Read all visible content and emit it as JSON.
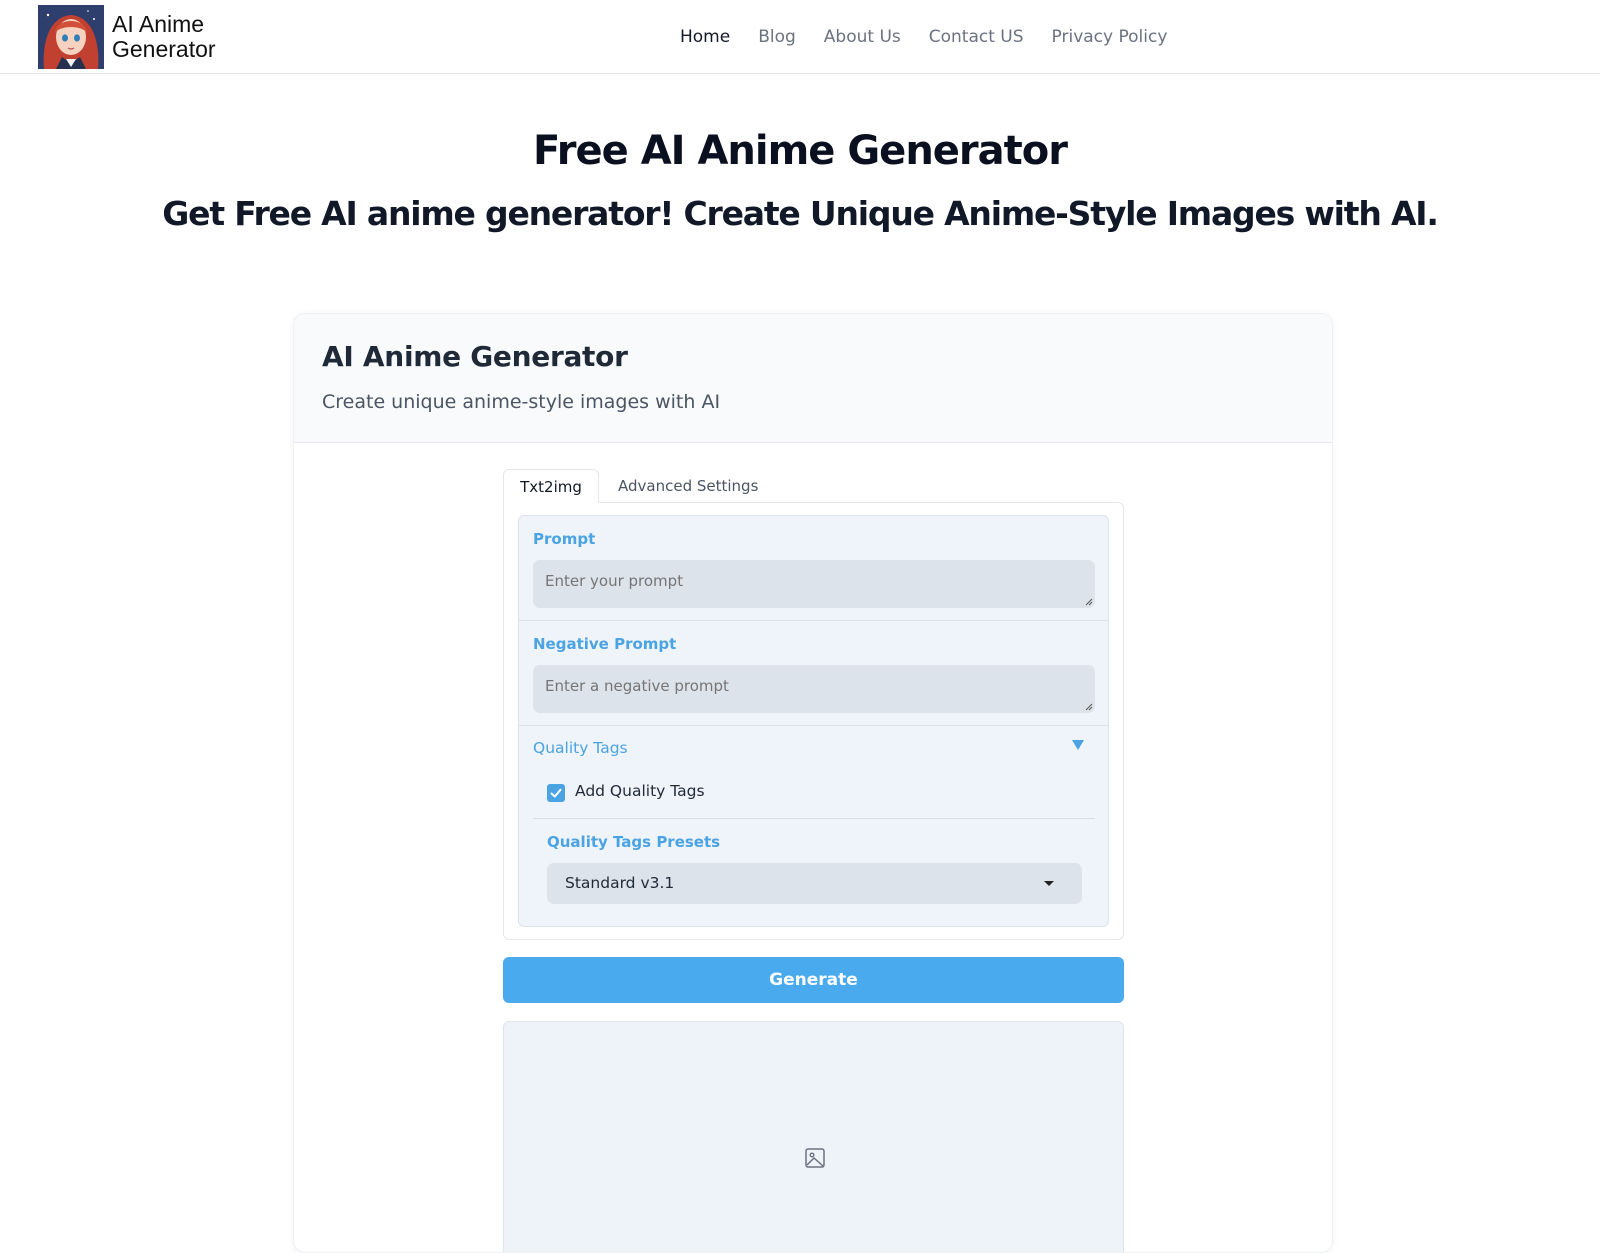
{
  "header": {
    "logo_line1": "AI Anime",
    "logo_line2": "Generator",
    "nav": [
      {
        "label": "Home"
      },
      {
        "label": "Blog"
      },
      {
        "label": "About Us"
      },
      {
        "label": "Contact US"
      },
      {
        "label": "Privacy Policy"
      }
    ]
  },
  "hero": {
    "title": "Free AI Anime Generator",
    "subtitle": "Get Free AI anime generator! Create Unique Anime-Style Images with AI."
  },
  "card": {
    "title": "AI Anime Generator",
    "description": "Create unique anime-style images with AI",
    "tabs": [
      {
        "label": "Txt2img",
        "active": true
      },
      {
        "label": "Advanced Settings",
        "active": false
      }
    ],
    "prompt": {
      "label": "Prompt",
      "placeholder": "Enter your prompt",
      "value": ""
    },
    "negative_prompt": {
      "label": "Negative Prompt",
      "placeholder": "Enter a negative prompt",
      "value": ""
    },
    "quality_tags": {
      "title": "Quality Tags",
      "checkbox_label": "Add Quality Tags",
      "checked": true,
      "presets_label": "Quality Tags Presets",
      "preset_selected": "Standard v3.1"
    },
    "generate_label": "Generate"
  },
  "colors": {
    "accent": "#4aa3e3",
    "button": "#4aaaee",
    "panel_bg": "#eff3fa",
    "input_bg": "#dde3ea"
  },
  "icons": {
    "logo": "anime-girl-avatar",
    "collapse": "triangle-down-icon",
    "check": "checkmark-icon",
    "select": "caret-down-icon",
    "output": "image-placeholder-icon"
  }
}
